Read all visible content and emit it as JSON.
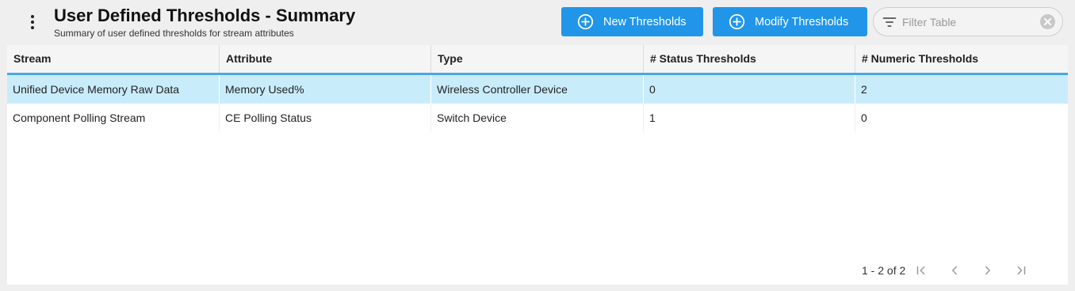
{
  "header": {
    "title": "User Defined Thresholds - Summary",
    "subtitle": "Summary of user defined thresholds for stream attributes"
  },
  "toolbar": {
    "new_label": "New Thresholds",
    "modify_label": "Modify Thresholds",
    "filter_placeholder": "Filter Table",
    "filter_value": ""
  },
  "table": {
    "columns": [
      "Stream",
      "Attribute",
      "Type",
      "# Status Thresholds",
      "# Numeric Thresholds"
    ],
    "rows": [
      {
        "cells": [
          "Unified Device Memory Raw Data",
          "Memory Used%",
          "Wireless Controller Device",
          "0",
          "2"
        ],
        "selected": true
      },
      {
        "cells": [
          "Component Polling Stream",
          "CE Polling Status",
          "Switch Device",
          "1",
          "0"
        ],
        "selected": false
      }
    ]
  },
  "pagination": {
    "range_label": "1 - 2 of 2"
  },
  "colors": {
    "accent": "#2196e8",
    "selected_row": "#c9ecfb",
    "header_underline": "#4aa6e6"
  },
  "icons": {
    "menu": "more-vertical-icon",
    "add": "add-circle-icon",
    "filter": "filter-icon",
    "clear": "clear-icon",
    "first": "first-page-icon",
    "prev": "chevron-left-icon",
    "next": "chevron-right-icon",
    "last": "last-page-icon"
  }
}
